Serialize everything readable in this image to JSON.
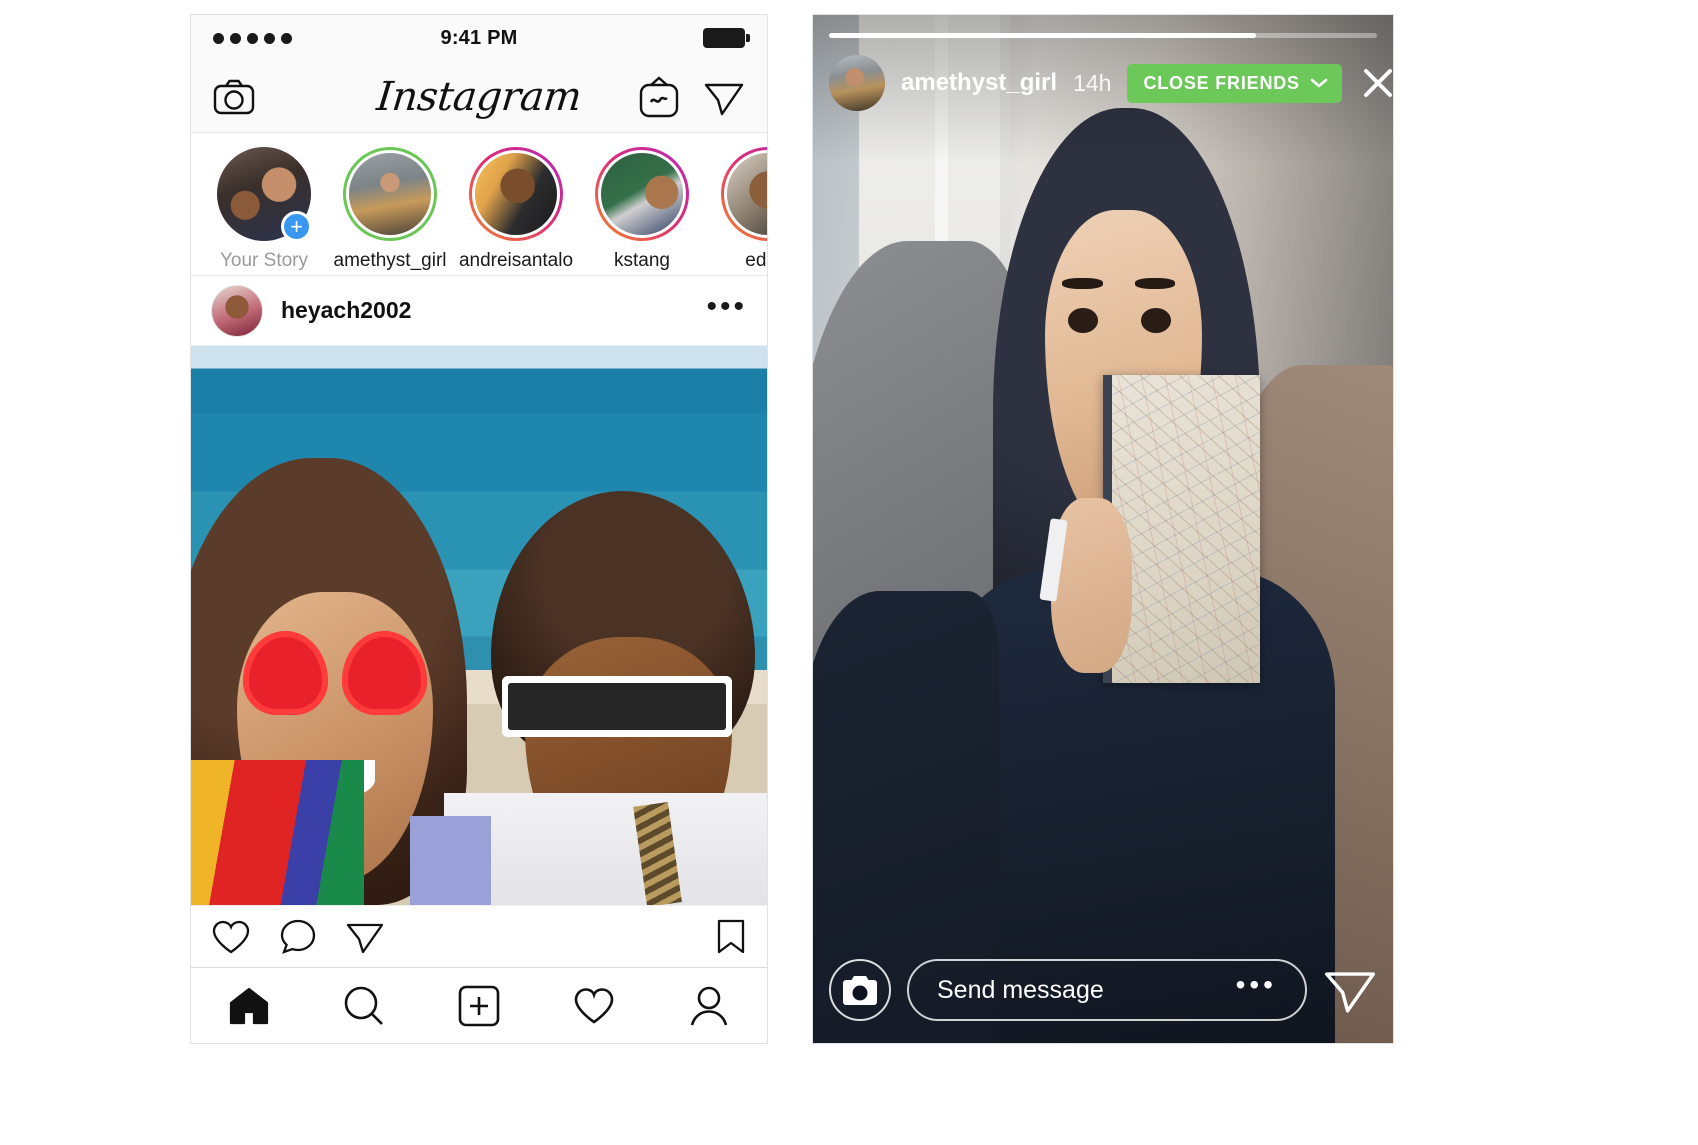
{
  "feed_phone": {
    "status_bar": {
      "time": "9:41 PM",
      "signal_icon": "signal-dots-icon",
      "battery_icon": "battery-full-icon"
    },
    "header": {
      "brand": "Instagram",
      "camera_icon": "camera-icon",
      "igtv_icon": "igtv-icon",
      "direct_icon": "paper-plane-icon"
    },
    "stories": [
      {
        "label": "Your Story",
        "ring": "none",
        "has_add_badge": true,
        "add_icon": "plus-icon"
      },
      {
        "label": "amethyst_girl",
        "ring": "close-friends"
      },
      {
        "label": "andreisantalo",
        "ring": "gradient"
      },
      {
        "label": "kstang",
        "ring": "gradient"
      },
      {
        "label": "edsal",
        "ring": "gradient"
      }
    ],
    "post": {
      "username": "heyach2002",
      "more_label": "•••",
      "avatar_name": "post-avatar",
      "actions": {
        "like_icon": "heart-icon",
        "comment_icon": "comment-bubble-icon",
        "share_icon": "paper-plane-icon",
        "save_icon": "bookmark-icon"
      }
    },
    "tabbar": [
      {
        "name": "tab-home",
        "icon": "home-icon",
        "active": true
      },
      {
        "name": "tab-search",
        "icon": "magnifier-icon",
        "active": false
      },
      {
        "name": "tab-create",
        "icon": "plus-square-icon",
        "active": false
      },
      {
        "name": "tab-activity",
        "icon": "heart-icon",
        "active": false
      },
      {
        "name": "tab-profile",
        "icon": "person-icon",
        "active": false
      }
    ]
  },
  "story_phone": {
    "progress_percent": 78,
    "username": "amethyst_girl",
    "timestamp": "14h",
    "close_friends_badge": "CLOSE FRIENDS",
    "chevron_icon": "chevron-down-icon",
    "close_icon": "close-x-icon",
    "camera_icon": "camera-icon",
    "message_placeholder": "Send message",
    "message_value": "",
    "message_more": "•••",
    "send_icon": "paper-plane-icon"
  },
  "colors": {
    "close_friends_green": "#6dc85a",
    "add_badge_blue": "#3897f0",
    "story_gradient_start": "#f58529",
    "story_gradient_mid": "#dd2a7b",
    "story_gradient_end": "#8134af",
    "page_background": "#ffffff"
  }
}
